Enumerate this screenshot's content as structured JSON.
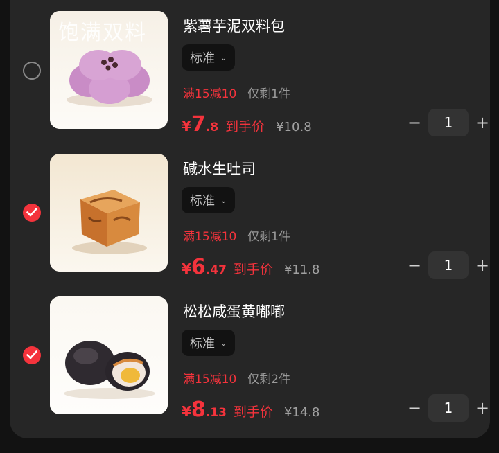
{
  "items": [
    {
      "selected": false,
      "image_watermark": "饱满双料",
      "name": "紫薯芋泥双料包",
      "spec": "标准",
      "promo": "满15减10",
      "stock": "仅剩1件",
      "currency": "¥",
      "price_int": "7",
      "price_dec": ".8",
      "price_tag": "到手价",
      "original_price": "¥10.8",
      "minus": "−",
      "quantity": "1",
      "plus": "+"
    },
    {
      "selected": true,
      "name": "碱水生吐司",
      "spec": "标准",
      "promo": "满15减10",
      "stock": "仅剩1件",
      "currency": "¥",
      "price_int": "6",
      "price_dec": ".47",
      "price_tag": "到手价",
      "original_price": "¥11.8",
      "minus": "−",
      "quantity": "1",
      "plus": "+"
    },
    {
      "selected": true,
      "name": "松松咸蛋黄嘟嘟",
      "spec": "标准",
      "promo": "满15减10",
      "stock": "仅剩2件",
      "currency": "¥",
      "price_int": "8",
      "price_dec": ".13",
      "price_tag": "到手价",
      "original_price": "¥14.8",
      "minus": "−",
      "quantity": "1",
      "plus": "+"
    }
  ],
  "colors": {
    "accent_red": "#f4333c",
    "card_bg": "#262626",
    "page_bg": "#121212"
  },
  "icons": {
    "unchecked": "radio-unchecked-icon",
    "checked": "checkmark-icon",
    "dropdown": "chevron-down-icon"
  }
}
